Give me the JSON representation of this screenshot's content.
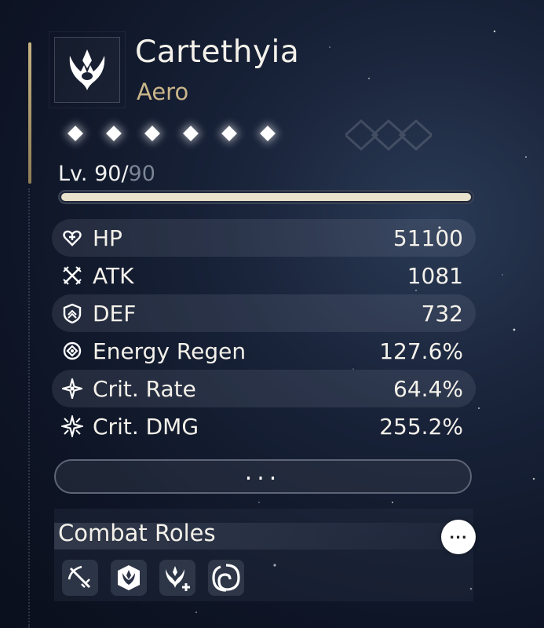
{
  "character": {
    "name": "Cartethyia",
    "element": "Aero",
    "rarity_count": 6,
    "level_current": "Lv. 90/",
    "level_max": "90",
    "xp_fill_fraction": 1.0
  },
  "stats": [
    {
      "label": "HP",
      "value": "51100",
      "icon": "heart-icon"
    },
    {
      "label": "ATK",
      "value": "1081",
      "icon": "crossed-swords-icon"
    },
    {
      "label": "DEF",
      "value": "732",
      "icon": "shield-icon"
    },
    {
      "label": "Energy Regen",
      "value": "127.6%",
      "icon": "energy-regen-icon"
    },
    {
      "label": "Crit. Rate",
      "value": "64.4%",
      "icon": "crit-rate-icon"
    },
    {
      "label": "Crit. DMG",
      "value": "255.2%",
      "icon": "crit-dmg-icon"
    }
  ],
  "more_button": {
    "label": "..."
  },
  "combat_roles": {
    "title": "Combat Roles",
    "more_label": "...",
    "icons": [
      "sword-slash-icon",
      "aero-shield-icon",
      "aero-heal-icon",
      "vortex-icon"
    ]
  },
  "colors": {
    "accent_gold": "#c9b58a",
    "text_primary": "#f4f1ea",
    "level_max_gray": "#7b8596"
  }
}
